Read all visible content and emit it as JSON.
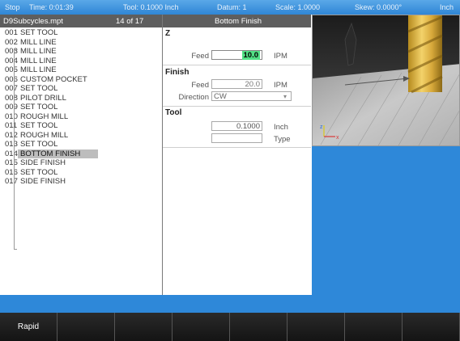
{
  "status": {
    "stop": "Stop",
    "time": "Time: 0:01:39",
    "tool": "Tool: 0.1000 Inch",
    "datum": "Datum: 1",
    "scale": "Scale: 1.0000",
    "skew": "Skew: 0.0000°",
    "units": "Inch"
  },
  "program": {
    "filename": "D9Subcycles.mpt",
    "position": "14 of 17",
    "steps": [
      {
        "num": "001",
        "label": "SET TOOL"
      },
      {
        "num": "002",
        "label": "MILL LINE"
      },
      {
        "num": "003",
        "label": "MILL LINE"
      },
      {
        "num": "004",
        "label": "MILL LINE"
      },
      {
        "num": "005",
        "label": "MILL LINE"
      },
      {
        "num": "006",
        "label": "CUSTOM POCKET"
      },
      {
        "num": "007",
        "label": "SET TOOL"
      },
      {
        "num": "008",
        "label": "PILOT DRILL"
      },
      {
        "num": "009",
        "label": "SET TOOL"
      },
      {
        "num": "010",
        "label": "ROUGH MILL"
      },
      {
        "num": "011",
        "label": "SET TOOL"
      },
      {
        "num": "012",
        "label": "ROUGH MILL"
      },
      {
        "num": "013",
        "label": "SET TOOL"
      },
      {
        "num": "014",
        "label": "BOTTOM FINISH"
      },
      {
        "num": "015",
        "label": "SIDE FINISH"
      },
      {
        "num": "016",
        "label": "SET TOOL"
      },
      {
        "num": "017",
        "label": "SIDE FINISH"
      }
    ]
  },
  "form": {
    "title": "Bottom Finish",
    "z": {
      "title": "Z",
      "feed_label": "Feed",
      "feed_value": "10.0",
      "feed_unit": "IPM"
    },
    "finish": {
      "title": "Finish",
      "feed_label": "Feed",
      "feed_value": "20.0",
      "feed_unit": "IPM",
      "direction_label": "Direction",
      "direction_value": "CW"
    },
    "tool": {
      "title": "Tool",
      "diameter_value": "0.1000",
      "diameter_unit": "Inch",
      "type_value": "",
      "type_label": "Type"
    }
  },
  "viewport": {
    "axis_z": "z",
    "axis_x": "x"
  },
  "softkeys": [
    "Rapid",
    "",
    "",
    "",
    "",
    "",
    "",
    ""
  ],
  "colors": {
    "status_bar": "#2f86d6",
    "panel_header": "#5e5e5e",
    "highlight_field": "#52e085",
    "blue_area": "#2e88d9",
    "softkey_bg": "#1e1e1e"
  }
}
